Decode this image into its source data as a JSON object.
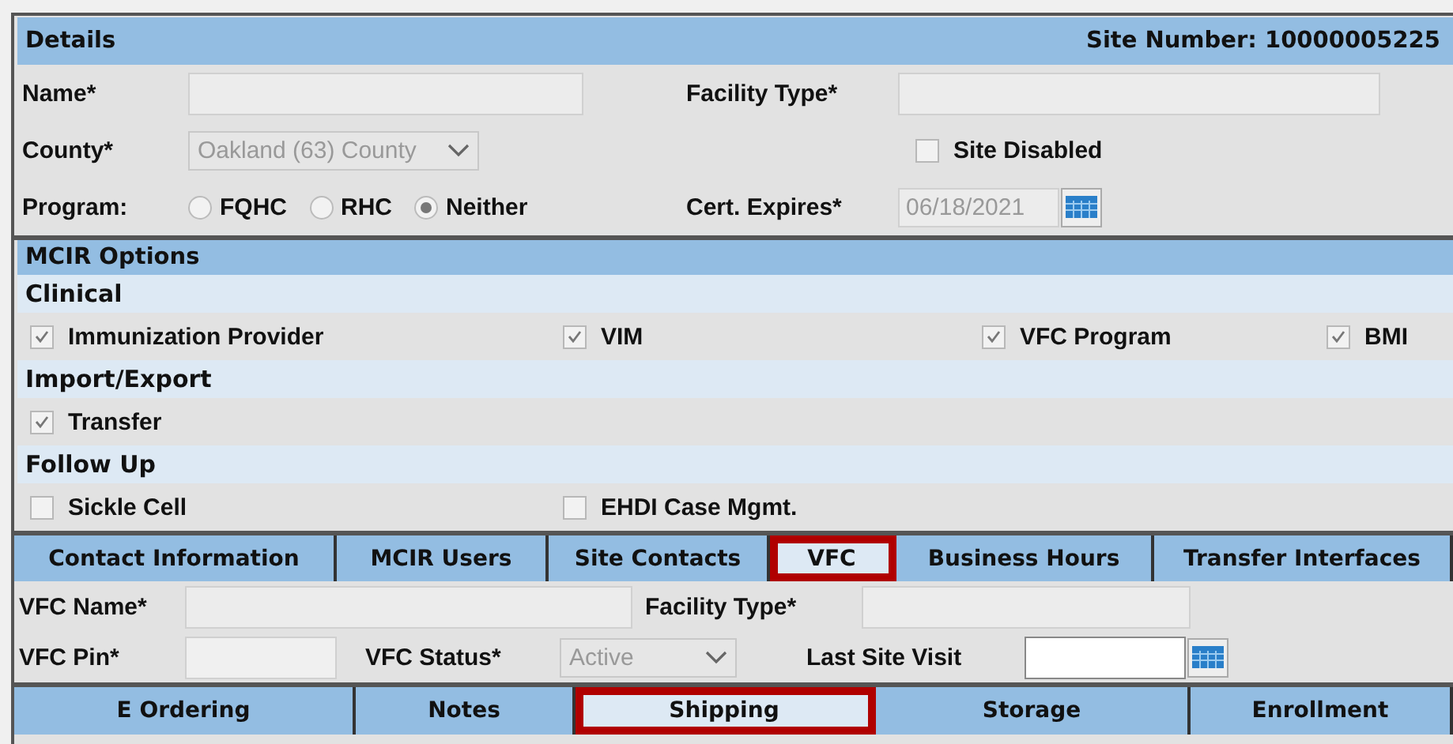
{
  "details": {
    "title": "Details",
    "site_number": "Site Number: 10000005225",
    "name": {
      "label": "Name*"
    },
    "facility_type": {
      "label": "Facility Type*"
    },
    "county": {
      "label": "County*",
      "value": "Oakland (63) County"
    },
    "site_disabled": {
      "label": "Site Disabled",
      "checked": false
    },
    "program": {
      "label": "Program:",
      "options": [
        {
          "label": "FQHC",
          "selected": false
        },
        {
          "label": "RHC",
          "selected": false
        },
        {
          "label": "Neither",
          "selected": true
        }
      ]
    },
    "cert_expires": {
      "label": "Cert. Expires*",
      "value": "06/18/2021"
    }
  },
  "mcir_options": {
    "title": "MCIR Options",
    "groups": [
      {
        "title": "Clinical",
        "items": [
          {
            "label": "Immunization Provider",
            "checked": true
          },
          {
            "label": "VIM",
            "checked": true
          },
          {
            "label": "VFC Program",
            "checked": true
          },
          {
            "label": "BMI",
            "checked": true
          }
        ]
      },
      {
        "title": "Import/Export",
        "items": [
          {
            "label": "Transfer",
            "checked": true
          }
        ]
      },
      {
        "title": "Follow Up",
        "items": [
          {
            "label": "Sickle Cell",
            "checked": false
          },
          {
            "label": "EHDI Case Mgmt.",
            "checked": false
          }
        ]
      }
    ]
  },
  "tabs": [
    {
      "label": "Contact Information",
      "selected": false
    },
    {
      "label": "MCIR Users",
      "selected": false
    },
    {
      "label": "Site Contacts",
      "selected": false
    },
    {
      "label": "VFC",
      "selected": true
    },
    {
      "label": "Business Hours",
      "selected": false
    },
    {
      "label": "Transfer Interfaces",
      "selected": false
    }
  ],
  "vfc": {
    "vfc_name": {
      "label": "VFC Name*"
    },
    "facility_type": {
      "label": "Facility Type*"
    },
    "vfc_pin": {
      "label": "VFC Pin*"
    },
    "vfc_status": {
      "label": "VFC Status*",
      "value": "Active"
    },
    "last_site_visit": {
      "label": "Last Site Visit"
    }
  },
  "sub_tabs": [
    {
      "label": "E Ordering",
      "selected": false
    },
    {
      "label": "Notes",
      "selected": false
    },
    {
      "label": "Shipping",
      "selected": true
    },
    {
      "label": "Storage",
      "selected": false
    },
    {
      "label": "Enrollment",
      "selected": false
    }
  ]
}
